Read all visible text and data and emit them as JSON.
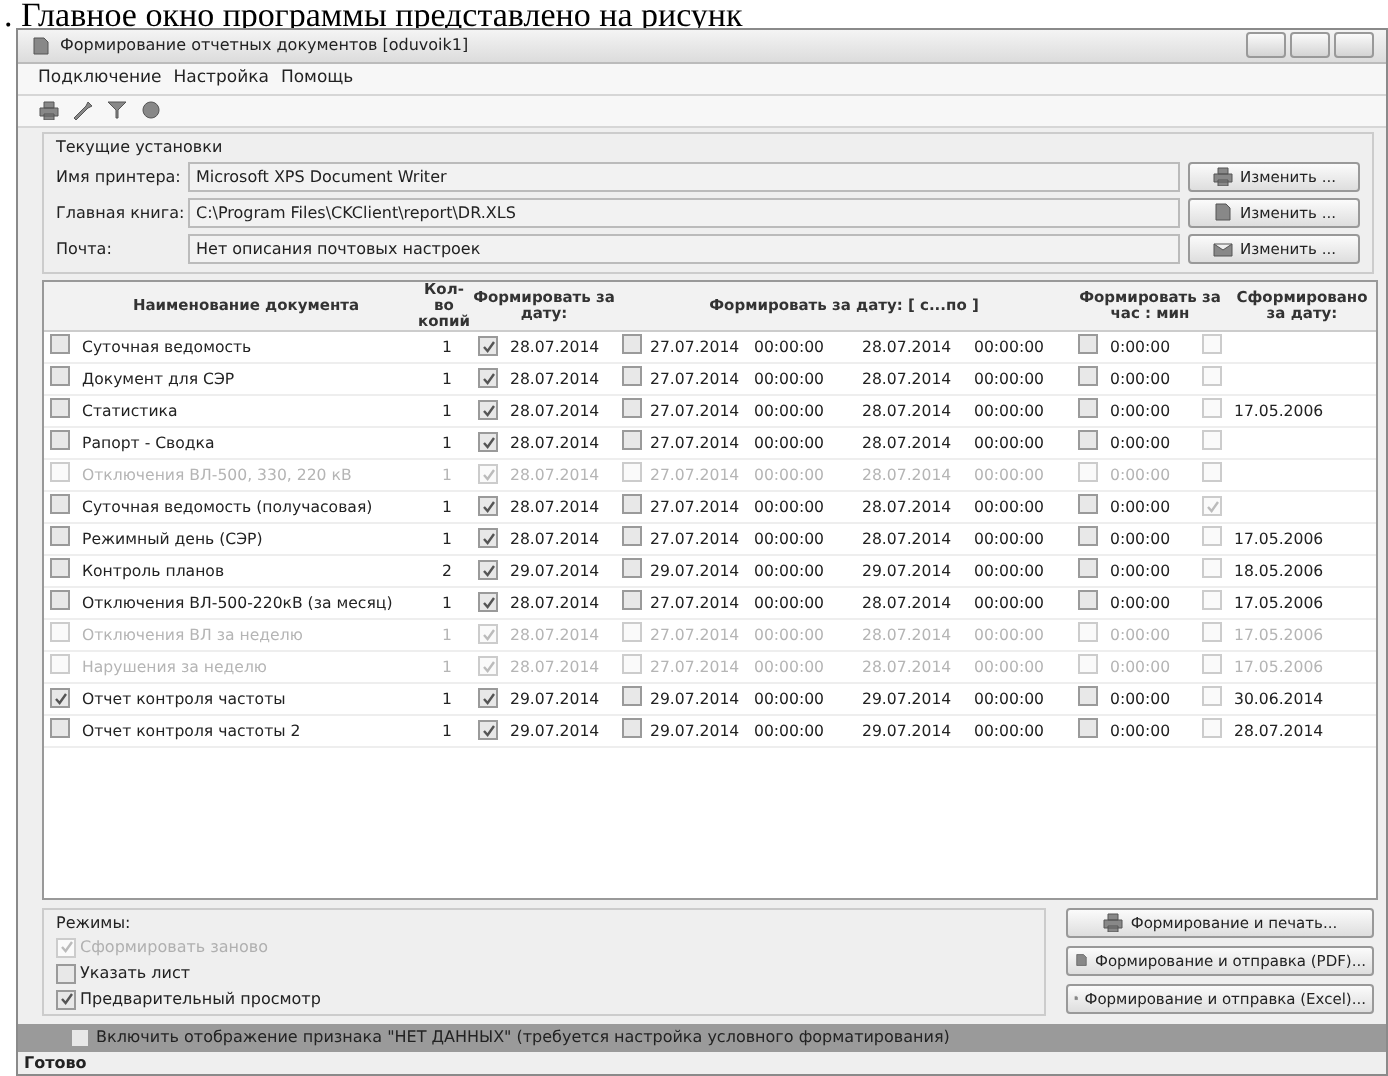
{
  "caption": ". Главное окно программы представлено на рисунк",
  "window": {
    "title": "Формирование отчетных документов [oduvoik1]"
  },
  "menu": [
    "Подключение",
    "Настройка",
    "Помощь"
  ],
  "settings": {
    "title": "Текущие установки",
    "fields": [
      {
        "label": "Имя принтера:",
        "value": "Microsoft XPS Document Writer",
        "button": "Изменить ..."
      },
      {
        "label": "Главная книга:",
        "value": "C:\\Program Files\\CKClient\\report\\DR.XLS",
        "button": "Изменить ..."
      },
      {
        "label": "Почта:",
        "value": "Нет описания почтовых настроек",
        "button": "Изменить ..."
      }
    ]
  },
  "table": {
    "columns": [
      "Наименование документа",
      "Кол-во копий",
      "Формировать за дату:",
      "Формировать за дату: [ с...по ]",
      "Формировать за час : мин",
      "Сформировано за дату:"
    ],
    "rows": [
      {
        "checked": false,
        "disabled": false,
        "name": "Суточная ведомость",
        "copies": "1",
        "date_checked": true,
        "date": "28.07.2014",
        "range_checked": false,
        "from_date": "27.07.2014",
        "from_time": "00:00:00",
        "to_date": "28.07.2014",
        "to_time": "00:00:00",
        "hour_checked": false,
        "time": "0:00:00",
        "done_checked": false
      },
      {
        "checked": false,
        "disabled": false,
        "name": "Документ для СЭР",
        "copies": "1",
        "date_checked": true,
        "date": "28.07.2014",
        "range_checked": false,
        "from_date": "27.07.2014",
        "from_time": "00:00:00",
        "to_date": "28.07.2014",
        "to_time": "00:00:00",
        "hour_checked": false,
        "time": "0:00:00",
        "done_checked": false
      },
      {
        "checked": false,
        "disabled": false,
        "name": "Статистика",
        "copies": "1",
        "date_checked": true,
        "date": "28.07.2014",
        "range_checked": false,
        "from_date": "27.07.2014",
        "from_time": "00:00:00",
        "to_date": "28.07.2014",
        "to_time": "00:00:00",
        "hour_checked": false,
        "time": "0:00:00",
        "done_checked": false,
        "formed": "17.05.2006"
      },
      {
        "checked": false,
        "disabled": false,
        "name": "Рапорт - Сводка",
        "copies": "1",
        "date_checked": true,
        "date": "28.07.2014",
        "range_checked": false,
        "from_date": "27.07.2014",
        "from_time": "00:00:00",
        "to_date": "28.07.2014",
        "to_time": "00:00:00",
        "hour_checked": false,
        "time": "0:00:00",
        "done_checked": false
      },
      {
        "checked": false,
        "disabled": true,
        "name": "Отключения ВЛ-500, 330, 220 кВ",
        "copies": "1",
        "date_checked": true,
        "date": "28.07.2014",
        "range_checked": false,
        "from_date": "27.07.2014",
        "from_time": "00:00:00",
        "to_date": "28.07.2014",
        "to_time": "00:00:00",
        "hour_checked": false,
        "time": "0:00:00",
        "done_checked": false
      },
      {
        "checked": false,
        "disabled": false,
        "name": "Суточная ведомость (получасовая)",
        "copies": "1",
        "date_checked": true,
        "date": "28.07.2014",
        "range_checked": false,
        "from_date": "27.07.2014",
        "from_time": "00:00:00",
        "to_date": "28.07.2014",
        "to_time": "00:00:00",
        "hour_checked": false,
        "time": "0:00:00",
        "done_checked": true
      },
      {
        "checked": false,
        "disabled": false,
        "name": "Режимный день (СЭР)",
        "copies": "1",
        "date_checked": true,
        "date": "28.07.2014",
        "range_checked": false,
        "from_date": "27.07.2014",
        "from_time": "00:00:00",
        "to_date": "28.07.2014",
        "to_time": "00:00:00",
        "hour_checked": false,
        "time": "0:00:00",
        "done_checked": false,
        "formed": "17.05.2006"
      },
      {
        "checked": false,
        "disabled": false,
        "name": "Контроль планов",
        "copies": "2",
        "date_checked": true,
        "date": "29.07.2014",
        "range_checked": false,
        "from_date": "29.07.2014",
        "from_time": "00:00:00",
        "to_date": "29.07.2014",
        "to_time": "00:00:00",
        "hour_checked": false,
        "time": "0:00:00",
        "done_checked": false,
        "formed": "18.05.2006"
      },
      {
        "checked": false,
        "disabled": false,
        "name": "Отключения ВЛ-500-220кВ (за месяц)",
        "copies": "1",
        "date_checked": true,
        "date": "28.07.2014",
        "range_checked": false,
        "from_date": "27.07.2014",
        "from_time": "00:00:00",
        "to_date": "28.07.2014",
        "to_time": "00:00:00",
        "hour_checked": false,
        "time": "0:00:00",
        "done_checked": false,
        "formed": "17.05.2006"
      },
      {
        "checked": false,
        "disabled": true,
        "name": "Отключения ВЛ за неделю",
        "copies": "1",
        "date_checked": true,
        "date": "28.07.2014",
        "range_checked": false,
        "from_date": "27.07.2014",
        "from_time": "00:00:00",
        "to_date": "28.07.2014",
        "to_time": "00:00:00",
        "hour_checked": false,
        "time": "0:00:00",
        "done_checked": false,
        "formed": "17.05.2006"
      },
      {
        "checked": false,
        "disabled": true,
        "name": "Нарушения за неделю",
        "copies": "1",
        "date_checked": true,
        "date": "28.07.2014",
        "range_checked": false,
        "from_date": "27.07.2014",
        "from_time": "00:00:00",
        "to_date": "28.07.2014",
        "to_time": "00:00:00",
        "hour_checked": false,
        "time": "0:00:00",
        "done_checked": false,
        "formed": "17.05.2006"
      },
      {
        "checked": true,
        "disabled": false,
        "name": "Отчет контроля частоты",
        "copies": "1",
        "date_checked": true,
        "date": "29.07.2014",
        "range_checked": false,
        "from_date": "29.07.2014",
        "from_time": "00:00:00",
        "to_date": "29.07.2014",
        "to_time": "00:00:00",
        "hour_checked": false,
        "time": "0:00:00",
        "done_checked": false,
        "formed": "30.06.2014"
      },
      {
        "checked": false,
        "disabled": false,
        "name": "Отчет контроля частоты 2",
        "copies": "1",
        "date_checked": true,
        "date": "29.07.2014",
        "range_checked": false,
        "from_date": "29.07.2014",
        "from_time": "00:00:00",
        "to_date": "29.07.2014",
        "to_time": "00:00:00",
        "hour_checked": false,
        "time": "0:00:00",
        "done_checked": false,
        "formed": "28.07.2014"
      }
    ]
  },
  "modes": {
    "title": "Режимы:",
    "options": [
      {
        "label": "Сформировать заново",
        "checked": true,
        "disabled": true
      },
      {
        "label": "Указать лист",
        "checked": false,
        "disabled": false
      },
      {
        "label": "Предварительный просмотр",
        "checked": true,
        "disabled": false
      }
    ]
  },
  "actions": [
    "Формирование и печать...",
    "Формирование и отправка (PDF)...",
    "Формирование и отправка (Excel)..."
  ],
  "no_data_option": {
    "label": "Включить отображение признака \"НЕТ ДАННЫХ\" (требуется настройка условного форматирования)",
    "checked": false
  },
  "status_bar": "Готово"
}
